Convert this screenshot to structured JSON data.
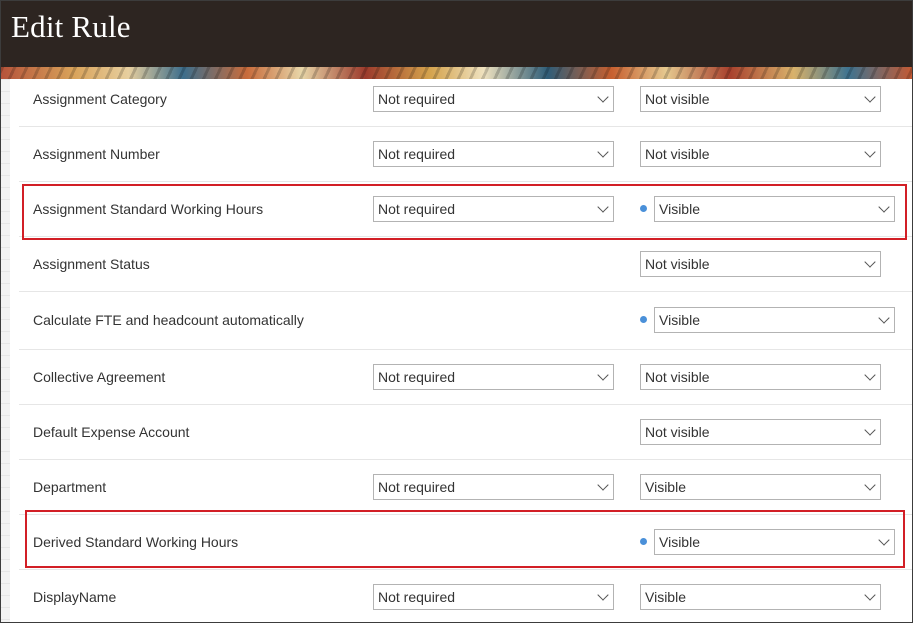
{
  "header": {
    "title": "Edit Rule"
  },
  "rows": [
    {
      "label": "Assignment Category",
      "required": "Not required",
      "visibility": "Not visible",
      "changed": false
    },
    {
      "label": "Assignment Number",
      "required": "Not required",
      "visibility": "Not visible",
      "changed": false
    },
    {
      "label": "Assignment Standard Working Hours",
      "required": "Not required",
      "visibility": "Visible",
      "changed": true
    },
    {
      "label": "Assignment Status",
      "required": null,
      "visibility": "Not visible",
      "changed": false
    },
    {
      "label": "Calculate FTE and headcount automatically",
      "required": null,
      "visibility": "Visible",
      "changed": true
    },
    {
      "label": "Collective Agreement",
      "required": "Not required",
      "visibility": "Not visible",
      "changed": false
    },
    {
      "label": "Default Expense Account",
      "required": null,
      "visibility": "Not visible",
      "changed": false
    },
    {
      "label": "Department",
      "required": "Not required",
      "visibility": "Visible",
      "changed": false
    },
    {
      "label": "Derived Standard Working Hours",
      "required": null,
      "visibility": "Visible",
      "changed": true
    },
    {
      "label": "DisplayName",
      "required": "Not required",
      "visibility": "Visible",
      "changed": false
    }
  ],
  "highlights": [
    "Assignment Standard Working Hours",
    "Derived Standard Working Hours"
  ],
  "colors": {
    "header_bg": "#2d2521",
    "highlight_border": "#d21f26",
    "changed_dot": "#4a90d9"
  }
}
